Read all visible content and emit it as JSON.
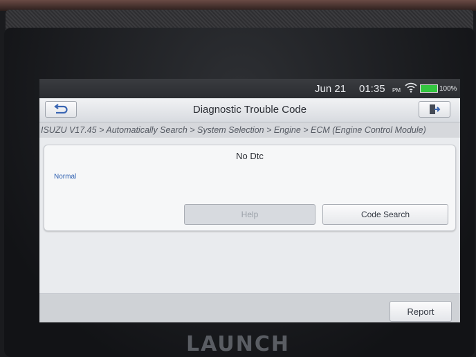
{
  "status_bar": {
    "date": "Jun 21",
    "time": "01:35",
    "ampm": "PM",
    "battery": "100%",
    "battery_color": "#34c640"
  },
  "header": {
    "title": "Diagnostic Trouble Code",
    "back_icon": "back-arrow-icon",
    "exit_icon": "exit-icon"
  },
  "breadcrumb": "ISUZU V17.45 > Automatically Search > System Selection > Engine > ECM (Engine Control Module)",
  "dtc_card": {
    "title": "No Dtc",
    "status": "Normal",
    "status_color": "#2d5fb0",
    "help_label": "Help",
    "code_search_label": "Code Search"
  },
  "footer": {
    "report_label": "Report"
  },
  "device": {
    "brand": "LAUNCH"
  }
}
